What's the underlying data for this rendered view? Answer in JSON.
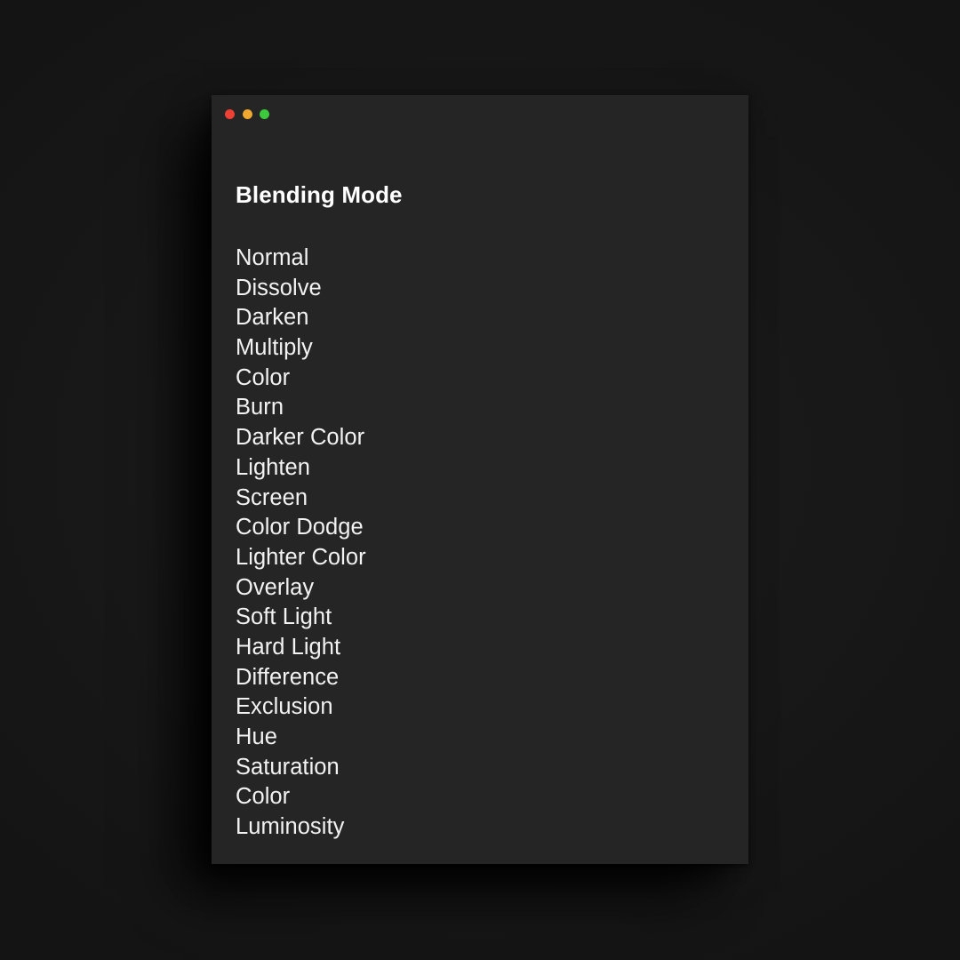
{
  "window": {
    "title": "Blending Mode",
    "traffic_lights": [
      {
        "name": "close",
        "color": "#ef4036"
      },
      {
        "name": "minimize",
        "color": "#f0a830"
      },
      {
        "name": "maximize",
        "color": "#3cc93c"
      }
    ],
    "card_color": "#252525",
    "background_color": "#171717",
    "text_color": "#f2f2f2",
    "title_color": "#ffffff"
  },
  "panel": {
    "heading": "Blending Mode",
    "modes": [
      "Normal",
      "Dissolve",
      "Darken",
      "Multiply",
      "Color",
      "Burn",
      "Darker Color",
      "Lighten",
      "Screen",
      "Color Dodge",
      "Lighter Color",
      "Overlay",
      "Soft Light",
      "Hard Light",
      "Difference",
      "Exclusion",
      "Hue",
      "Saturation",
      "Color",
      "Luminosity"
    ]
  }
}
